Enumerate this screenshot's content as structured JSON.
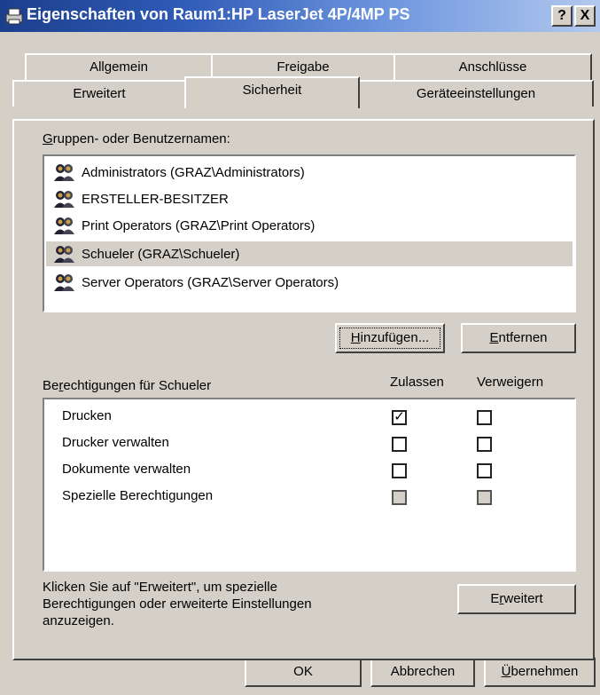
{
  "window": {
    "title": "Eigenschaften von Raum1:HP LaserJet 4P/4MP PS",
    "help_btn": "?",
    "close_btn": "X"
  },
  "tabs_row1": [
    "Allgemein",
    "Freigabe",
    "Anschlüsse"
  ],
  "tabs_row2": [
    "Erweitert",
    "Sicherheit",
    "Geräteeinstellungen"
  ],
  "active_tab": "Sicherheit",
  "groups": {
    "label": "Gruppen- oder Benutzernamen:",
    "items": [
      "Administrators (GRAZ\\Administrators)",
      "ERSTELLER-BESITZER",
      "Print Operators (GRAZ\\Print Operators)",
      "Schueler (GRAZ\\Schueler)",
      "Server Operators (GRAZ\\Server Operators)"
    ],
    "selected": "Schueler (GRAZ\\Schueler)",
    "add_button": "Hinzufügen...",
    "remove_button": "Entfernen"
  },
  "permissions": {
    "label": "Berechtigungen für Schueler",
    "col_allow": "Zulassen",
    "col_deny": "Verweigern",
    "rows": [
      {
        "name": "Drucken",
        "allow": true,
        "deny": false,
        "disabled": false
      },
      {
        "name": "Drucker verwalten",
        "allow": false,
        "deny": false,
        "disabled": false
      },
      {
        "name": "Dokumente verwalten",
        "allow": false,
        "deny": false,
        "disabled": false
      },
      {
        "name": "Spezielle Berechtigungen",
        "allow": false,
        "deny": false,
        "disabled": true
      }
    ]
  },
  "advanced": {
    "info_line1": "Klicken Sie auf \"Erweitert\", um spezielle",
    "info_line2": "Berechtigungen oder erweiterte Einstellungen",
    "info_line3": "anzuzeigen.",
    "button": "Erweitert"
  },
  "footer": {
    "ok": "OK",
    "cancel": "Abbrechen",
    "apply": "Übernehmen"
  }
}
